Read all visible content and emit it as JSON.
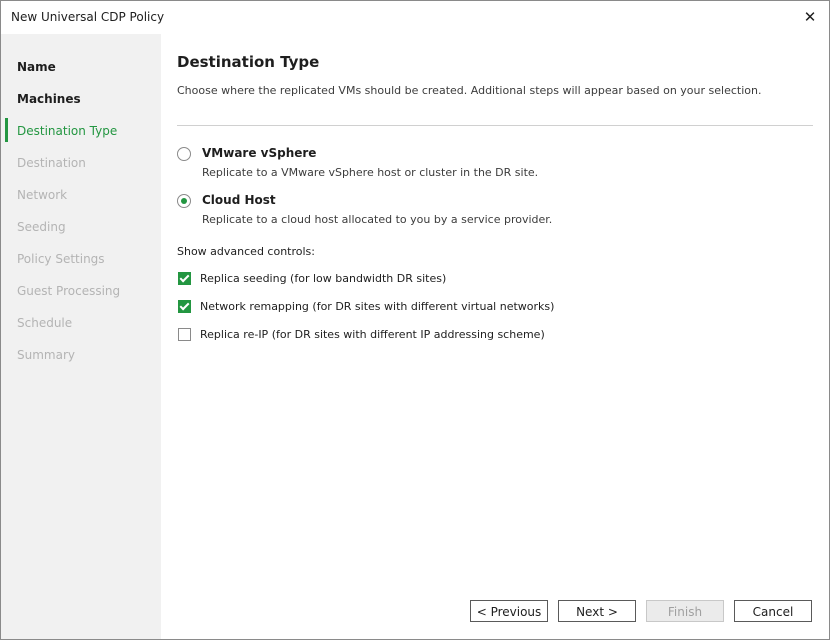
{
  "window": {
    "title": "New Universal CDP Policy"
  },
  "sidebar": {
    "items": [
      {
        "label": "Name",
        "state": "done"
      },
      {
        "label": "Machines",
        "state": "done"
      },
      {
        "label": "Destination Type",
        "state": "active"
      },
      {
        "label": "Destination",
        "state": "pending"
      },
      {
        "label": "Network",
        "state": "pending"
      },
      {
        "label": "Seeding",
        "state": "pending"
      },
      {
        "label": "Policy Settings",
        "state": "pending"
      },
      {
        "label": "Guest Processing",
        "state": "pending"
      },
      {
        "label": "Schedule",
        "state": "pending"
      },
      {
        "label": "Summary",
        "state": "pending"
      }
    ]
  },
  "main": {
    "heading": "Destination Type",
    "description": "Choose where the replicated VMs should be created. Additional steps will appear based on your selection.",
    "options": [
      {
        "title": "VMware vSphere",
        "subtitle": "Replicate to a VMware vSphere host or cluster in the DR site.",
        "selected": false
      },
      {
        "title": "Cloud Host",
        "subtitle": "Replicate to a cloud host allocated to you by a service provider.",
        "selected": true
      }
    ],
    "advanced_label": "Show advanced controls:",
    "checkboxes": [
      {
        "label": "Replica seeding (for low bandwidth DR sites)",
        "checked": true
      },
      {
        "label": "Network remapping (for DR sites with different virtual networks)",
        "checked": true
      },
      {
        "label": "Replica re-IP (for DR sites with different IP addressing scheme)",
        "checked": false
      }
    ]
  },
  "footer": {
    "previous": "< Previous",
    "next": "Next >",
    "finish": "Finish",
    "cancel": "Cancel"
  },
  "colors": {
    "accent": "#239641",
    "sidebar_bg": "#f1f1f1"
  }
}
